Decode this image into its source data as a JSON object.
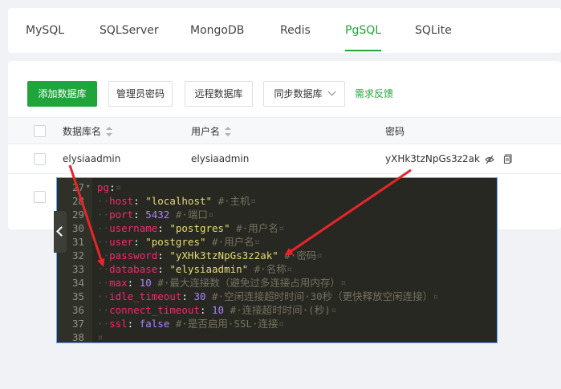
{
  "tabs": [
    "MySQL",
    "SQLServer",
    "MongoDB",
    "Redis",
    "PgSQL",
    "SQLite"
  ],
  "toolbar": {
    "add": "添加数据库",
    "admin_password": "管理员密码",
    "remote": "远程数据库",
    "sync": "同步数据库",
    "feedback": "需求反馈"
  },
  "table": {
    "headers": {
      "name": "数据库名",
      "user": "用户名",
      "password": "密码"
    },
    "row": {
      "name": "elysiaadmin",
      "user": "elysiaadmin",
      "password": "yXHk3tzNpGs3z2ak"
    }
  },
  "code": {
    "line_numbers": [
      "27",
      "28",
      "29",
      "30",
      "31",
      "32",
      "33",
      "34",
      "35",
      "36",
      "37",
      "38"
    ],
    "lines": [
      [
        {
          "t": "k",
          "v": "pg"
        },
        {
          "t": "p",
          "v": ":"
        },
        {
          "t": "w",
          "v": "¤"
        }
      ],
      [
        {
          "t": "w",
          "v": "··"
        },
        {
          "t": "k",
          "v": "host"
        },
        {
          "t": "p",
          "v": ": "
        },
        {
          "t": "s",
          "v": "\"localhost\""
        },
        {
          "t": "p",
          "v": " "
        },
        {
          "t": "c",
          "v": "#·主机"
        },
        {
          "t": "w",
          "v": "¤"
        }
      ],
      [
        {
          "t": "w",
          "v": "··"
        },
        {
          "t": "k",
          "v": "port"
        },
        {
          "t": "p",
          "v": ": "
        },
        {
          "t": "n",
          "v": "5432"
        },
        {
          "t": "p",
          "v": " "
        },
        {
          "t": "c",
          "v": "#·端口"
        },
        {
          "t": "w",
          "v": "¤"
        }
      ],
      [
        {
          "t": "w",
          "v": "··"
        },
        {
          "t": "k",
          "v": "username"
        },
        {
          "t": "p",
          "v": ": "
        },
        {
          "t": "s",
          "v": "\"postgres\""
        },
        {
          "t": "p",
          "v": " "
        },
        {
          "t": "c",
          "v": "#·用户名"
        },
        {
          "t": "w",
          "v": "¤"
        }
      ],
      [
        {
          "t": "w",
          "v": "··"
        },
        {
          "t": "k",
          "v": "user"
        },
        {
          "t": "p",
          "v": ": "
        },
        {
          "t": "s",
          "v": "\"postgres\""
        },
        {
          "t": "p",
          "v": " "
        },
        {
          "t": "c",
          "v": "#·用户名"
        },
        {
          "t": "w",
          "v": "¤"
        }
      ],
      [
        {
          "t": "w",
          "v": "··"
        },
        {
          "t": "k",
          "v": "password"
        },
        {
          "t": "p",
          "v": ": "
        },
        {
          "t": "s",
          "v": "\"yXHk3tzNpGs3z2ak\""
        },
        {
          "t": "p",
          "v": " "
        },
        {
          "t": "c",
          "v": "#·密码"
        },
        {
          "t": "w",
          "v": "¤"
        }
      ],
      [
        {
          "t": "w",
          "v": "··"
        },
        {
          "t": "k",
          "v": "database"
        },
        {
          "t": "p",
          "v": ": "
        },
        {
          "t": "s",
          "v": "\"elysiaadmin\""
        },
        {
          "t": "p",
          "v": " "
        },
        {
          "t": "c",
          "v": "#·名称"
        },
        {
          "t": "w",
          "v": "¤"
        }
      ],
      [
        {
          "t": "w",
          "v": "··"
        },
        {
          "t": "k",
          "v": "max"
        },
        {
          "t": "p",
          "v": ": "
        },
        {
          "t": "n",
          "v": "10"
        },
        {
          "t": "p",
          "v": " "
        },
        {
          "t": "c",
          "v": "#·最大连接数（避免过多连接占用内存）"
        },
        {
          "t": "w",
          "v": "¤"
        }
      ],
      [
        {
          "t": "w",
          "v": "··"
        },
        {
          "t": "k",
          "v": "idle_timeout"
        },
        {
          "t": "p",
          "v": ": "
        },
        {
          "t": "n",
          "v": "30"
        },
        {
          "t": "p",
          "v": " "
        },
        {
          "t": "c",
          "v": "#·空闲连接超时时间·30秒（更快释放空闲连接）"
        },
        {
          "t": "w",
          "v": "¤"
        }
      ],
      [
        {
          "t": "w",
          "v": "··"
        },
        {
          "t": "k",
          "v": "connect_timeout"
        },
        {
          "t": "p",
          "v": ": "
        },
        {
          "t": "n",
          "v": "10"
        },
        {
          "t": "p",
          "v": " "
        },
        {
          "t": "c",
          "v": "#·连接超时时间·(秒)"
        },
        {
          "t": "w",
          "v": "¤"
        }
      ],
      [
        {
          "t": "w",
          "v": "··"
        },
        {
          "t": "k",
          "v": "ssl"
        },
        {
          "t": "p",
          "v": ": "
        },
        {
          "t": "n",
          "v": "false"
        },
        {
          "t": "p",
          "v": " "
        },
        {
          "t": "c",
          "v": "#·是否启用·SSL·连接"
        },
        {
          "t": "w",
          "v": "¤"
        }
      ],
      [
        {
          "t": "w",
          "v": "¤"
        }
      ]
    ]
  },
  "colors": {
    "accent": "#20a53a",
    "arrow": "#e8252b",
    "editor_bg": "#272822"
  }
}
